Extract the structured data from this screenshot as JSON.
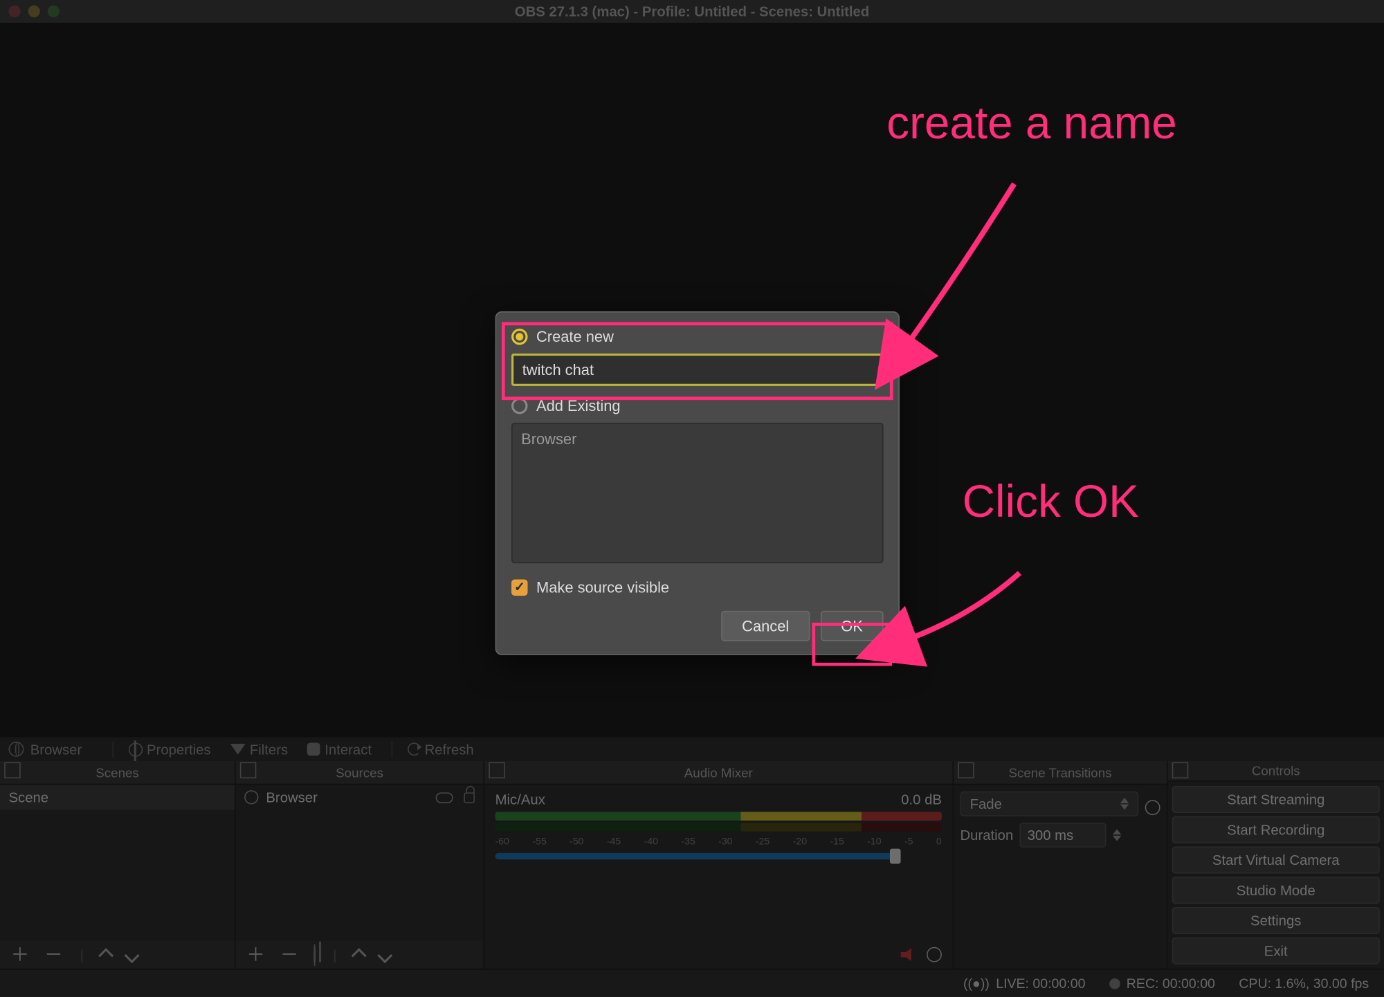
{
  "window": {
    "title": "OBS 27.1.3 (mac) - Profile: Untitled - Scenes: Untitled"
  },
  "srcRow": {
    "browserLabel": "Browser",
    "properties": "Properties",
    "filters": "Filters",
    "interact": "Interact",
    "refresh": "Refresh"
  },
  "panels": {
    "scenes": {
      "header": "Scenes",
      "item": "Scene"
    },
    "sources": {
      "header": "Sources",
      "item": "Browser"
    },
    "mixer": {
      "header": "Audio Mixer",
      "channel": "Mic/Aux",
      "db": "0.0 dB",
      "scale": [
        "-60",
        "-55",
        "-50",
        "-45",
        "-40",
        "-35",
        "-30",
        "-25",
        "-20",
        "-15",
        "-10",
        "-5",
        "0"
      ]
    },
    "transitions": {
      "header": "Scene Transitions",
      "selected": "Fade",
      "durationLabel": "Duration",
      "durationValue": "300 ms"
    },
    "controls": {
      "header": "Controls",
      "buttons": [
        "Start Streaming",
        "Start Recording",
        "Start Virtual Camera",
        "Studio Mode",
        "Settings",
        "Exit"
      ]
    }
  },
  "status": {
    "live": "LIVE: 00:00:00",
    "rec": "REC: 00:00:00",
    "cpu": "CPU: 1.6%, 30.00 fps"
  },
  "modal": {
    "createNewLabel": "Create new",
    "nameValue": "twitch chat",
    "addExistingLabel": "Add Existing",
    "existingItem": "Browser",
    "makeVisibleLabel": "Make source visible",
    "cancel": "Cancel",
    "ok": "OK"
  },
  "annotations": {
    "a1": "create a name",
    "a2": "Click OK"
  }
}
